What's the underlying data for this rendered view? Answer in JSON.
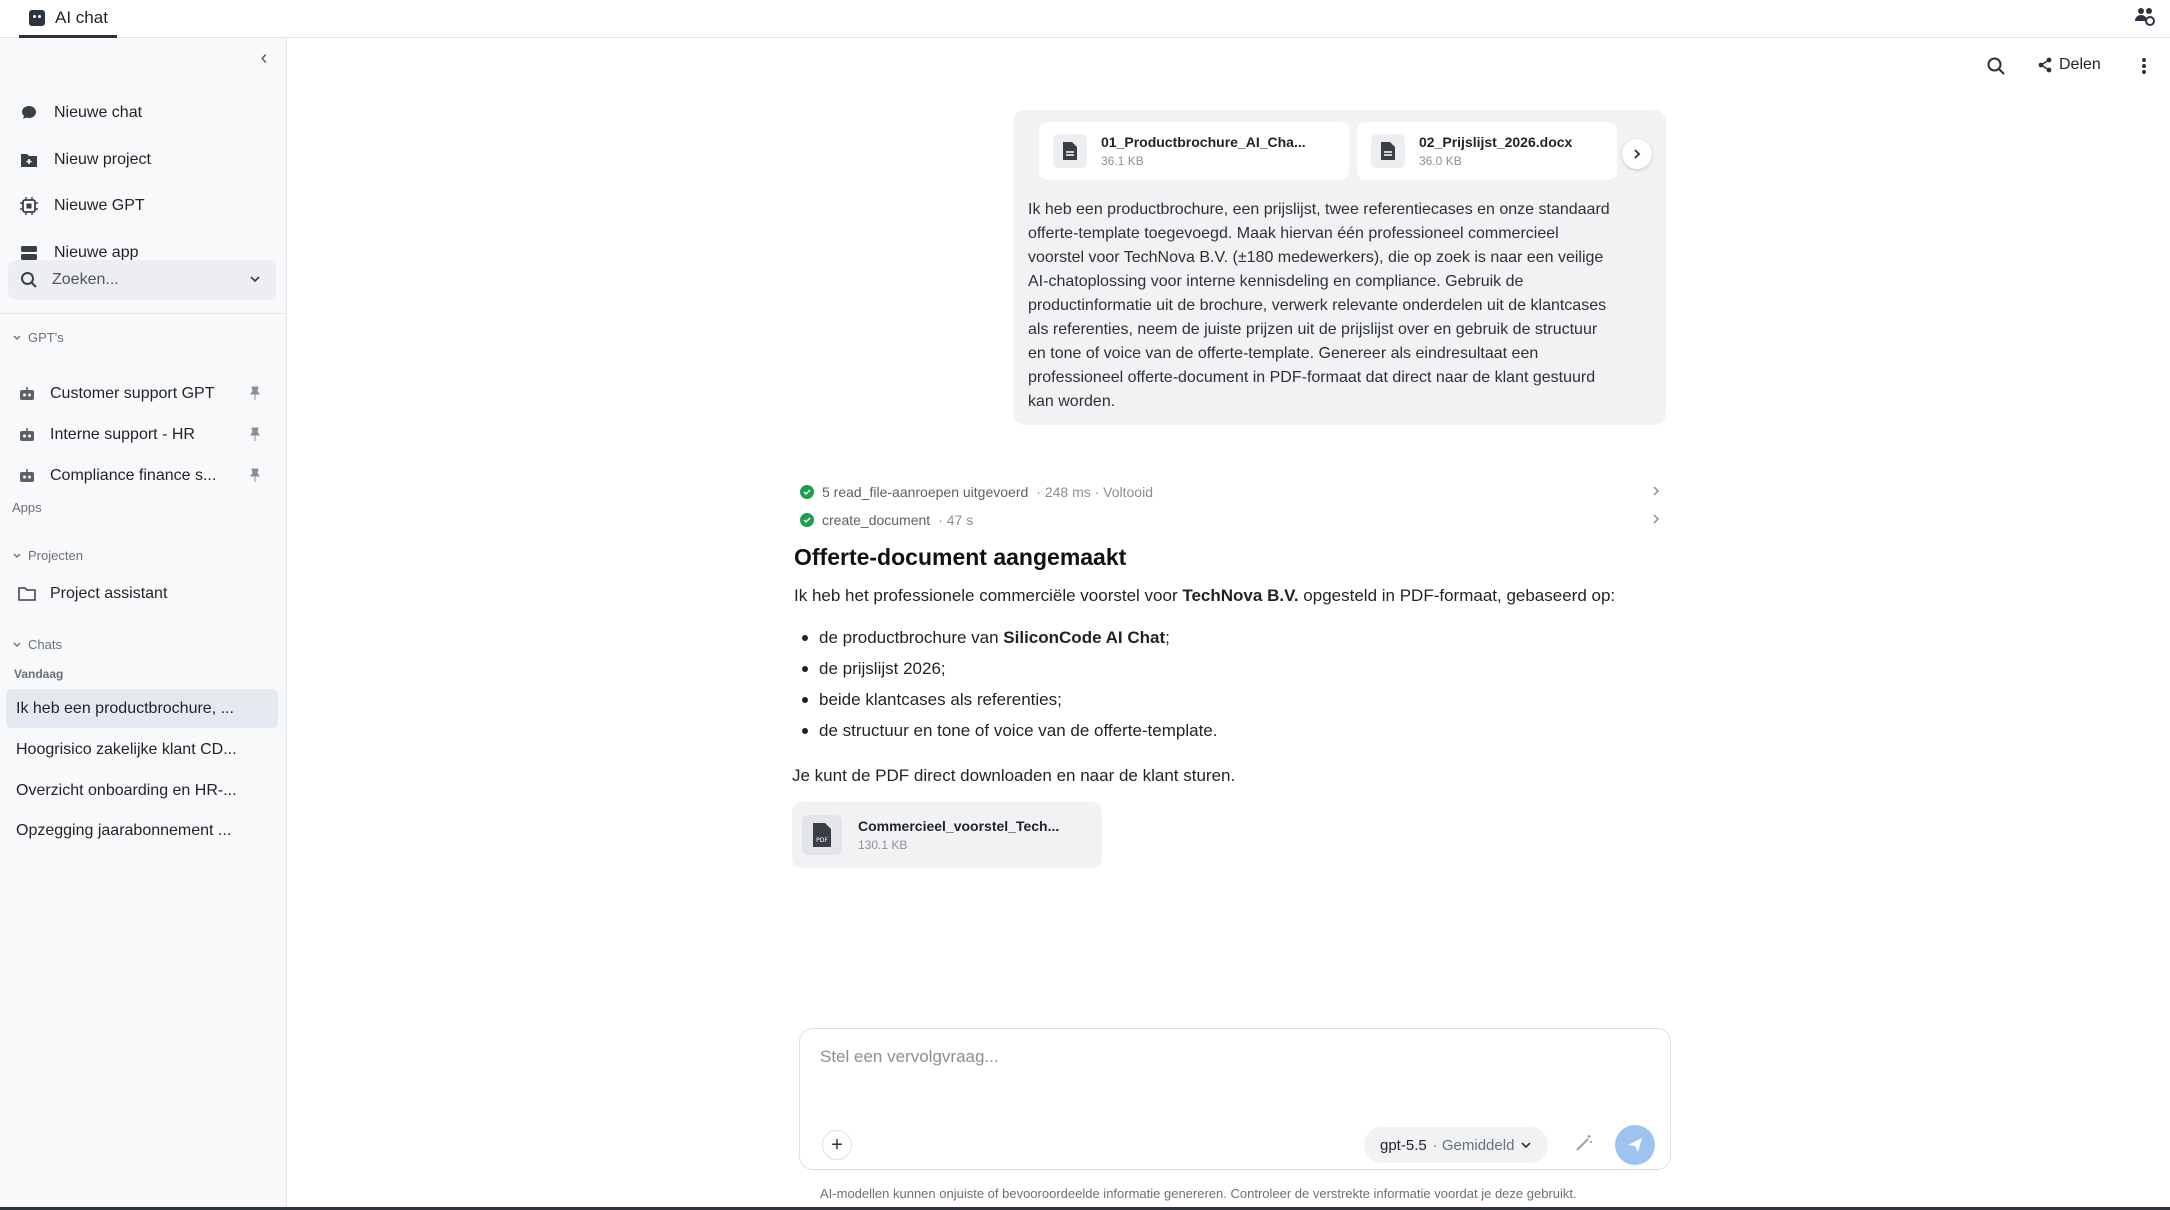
{
  "tabs": [
    {
      "label": "AI chat"
    }
  ],
  "sidebar": {
    "nav": [
      {
        "label": "Nieuwe chat",
        "icon": "chat-bubble-icon"
      },
      {
        "label": "Nieuw project",
        "icon": "folder-plus-icon"
      },
      {
        "label": "Nieuwe GPT",
        "icon": "cpu-icon"
      },
      {
        "label": "Nieuwe app",
        "icon": "app-icon"
      }
    ],
    "search_placeholder": "Zoeken...",
    "gpts_label": "GPT's",
    "gpts": [
      {
        "label": "Customer support GPT"
      },
      {
        "label": "Interne support - HR"
      },
      {
        "label": "Compliance finance s..."
      }
    ],
    "apps_label": "Apps",
    "projects_label": "Projecten",
    "projects": [
      {
        "label": "Project assistant"
      }
    ],
    "chats_label": "Chats",
    "today_label": "Vandaag",
    "chats": [
      {
        "label": "Ik heb een productbrochure, ...",
        "active": true
      },
      {
        "label": "Hoogrisico zakelijke klant CD..."
      },
      {
        "label": "Overzicht onboarding en HR-..."
      },
      {
        "label": "Opzegging jaarabonnement ..."
      }
    ]
  },
  "toolbar": {
    "share_label": "Delen"
  },
  "user_message": {
    "attachments": [
      {
        "name": "01_Productbrochure_AI_Cha...",
        "size": "36.1 KB"
      },
      {
        "name": "02_Prijslijst_2026.docx",
        "size": "36.0 KB"
      }
    ],
    "text_lines": [
      "Ik heb een productbrochure, een prijslijst, twee referentiecases en onze standaard",
      "offerte-template toegevoegd. Maak hiervan één professioneel commercieel",
      "voorstel voor TechNova B.V. (±180 medewerkers), die op zoek is naar een veilige",
      "AI-chatoplossing voor interne kennisdeling en compliance. Gebruik de",
      "productinformatie uit de brochure, verwerk relevante onderdelen uit de klantcases",
      "als referenties, neem de juiste prijzen uit de prijslijst over en gebruik de structuur",
      "en tone of voice van de offerte-template. Genereer als eindresultaat een",
      "professioneel offerte-document in PDF-formaat dat direct naar de klant gestuurd",
      "kan worden."
    ]
  },
  "tool_calls": [
    {
      "label": "5 read_file-aanroepen uitgevoerd",
      "meta": "· 248 ms · Voltooid"
    },
    {
      "label": "create_document",
      "meta": "· 47 s"
    }
  ],
  "answer": {
    "title": "Offerte-document aangemaakt",
    "intro_pre": "Ik heb het professionele commerciële voorstel voor ",
    "intro_bold": "TechNova B.V.",
    "intro_post": " opgesteld in PDF-formaat, gebaseerd op:",
    "bullet1_pre": "de productbrochure van ",
    "bullet1_bold": "SiliconCode AI Chat",
    "bullet1_post": ";",
    "bullets": [
      "de prijslijst 2026;",
      "beide klantcases als referenties;",
      "de structuur en tone of voice van de offerte-template."
    ],
    "outro": "Je kunt de PDF direct downloaden en naar de klant sturen.",
    "file": {
      "name": "Commercieel_voorstel_Tech...",
      "size": "130.1 KB",
      "badge": "PDF"
    }
  },
  "composer": {
    "placeholder": "Stel een vervolgvraag...",
    "model": "gpt-5.5",
    "effort": "· Gemiddeld"
  },
  "disclaimer": "AI-modellen kunnen onjuiste of bevooroordeelde informatie genereren. Controleer de verstrekte informatie voordat je deze gebruikt.",
  "colors": {
    "accent": "#2d3340",
    "success": "#1e9e4a",
    "send": "#9ec3ee"
  }
}
